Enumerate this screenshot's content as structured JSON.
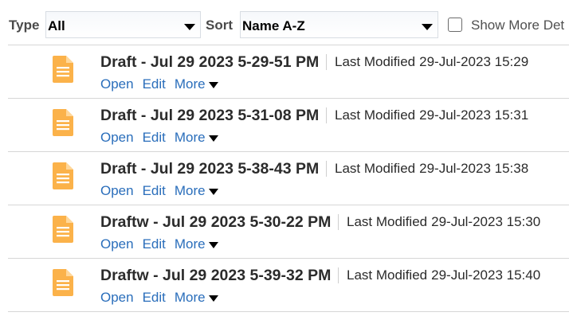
{
  "toolbar": {
    "type_label": "Type",
    "type_value": "All",
    "sort_label": "Sort",
    "sort_value": "Name A-Z",
    "show_more_label": "Show More Det",
    "show_more_checked": false
  },
  "list": {
    "modified_label": "Last Modified",
    "actions": {
      "open": "Open",
      "edit": "Edit",
      "more": "More"
    },
    "items": [
      {
        "title": "Draft - Jul 29 2023 5-29-51 PM",
        "modified": "29-Jul-2023 15:29",
        "icon": "document-icon"
      },
      {
        "title": "Draft - Jul 29 2023 5-31-08 PM",
        "modified": "29-Jul-2023 15:31",
        "icon": "document-icon"
      },
      {
        "title": "Draft - Jul 29 2023 5-38-43 PM",
        "modified": "29-Jul-2023 15:38",
        "icon": "document-icon"
      },
      {
        "title": "Draftw - Jul 29 2023 5-30-22 PM",
        "modified": "29-Jul-2023 15:30",
        "icon": "document-icon"
      },
      {
        "title": "Draftw - Jul 29 2023 5-39-32 PM",
        "modified": "29-Jul-2023 15:40",
        "icon": "document-icon"
      }
    ]
  },
  "colors": {
    "icon": "#fbb24a",
    "link": "#2a6ebb",
    "divider": "#d6d6d6"
  }
}
